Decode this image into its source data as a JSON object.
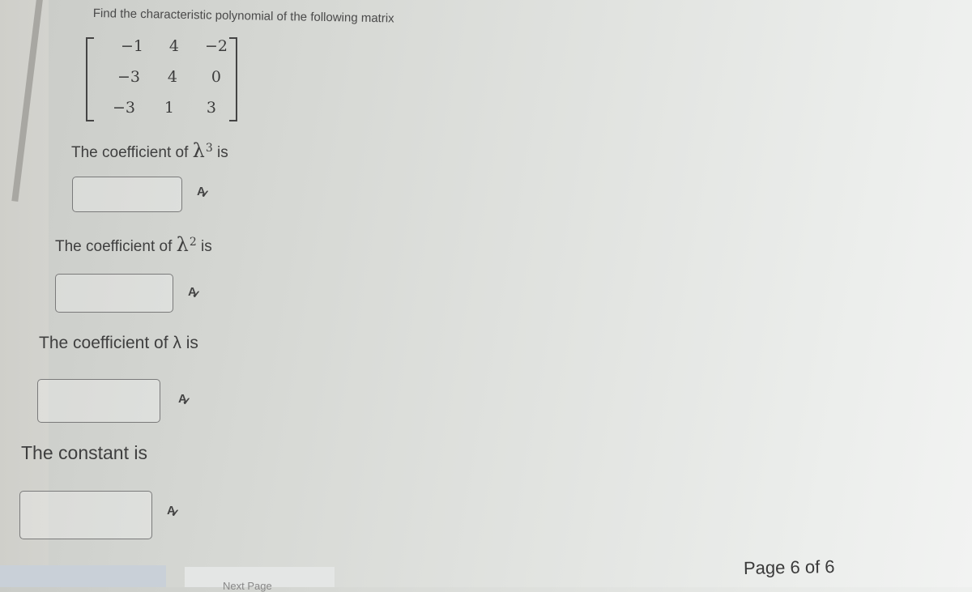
{
  "question": {
    "prompt": "Find the characteristic polynomial of the following matrix",
    "matrix": [
      [
        "−1",
        "4",
        "−2"
      ],
      [
        "−3",
        "4",
        "0"
      ],
      [
        "−3",
        "1",
        "3"
      ]
    ]
  },
  "fields": [
    {
      "label_prefix": "The coefficient of ",
      "symbol": "λ",
      "exponent": "3",
      "label_suffix": " is",
      "value": "",
      "icon": "spellcheck-icon"
    },
    {
      "label_prefix": "The coefficient of ",
      "symbol": "λ",
      "exponent": "2",
      "label_suffix": " is",
      "value": "",
      "icon": "spellcheck-icon"
    },
    {
      "label_prefix": "The coefficient of ",
      "symbol": "λ",
      "exponent": "",
      "label_suffix": " is",
      "value": "",
      "icon": "spellcheck-icon"
    },
    {
      "label_prefix": "The constant is",
      "symbol": "",
      "exponent": "",
      "label_suffix": "",
      "value": "",
      "icon": "spellcheck-icon"
    }
  ],
  "footer": {
    "page_indicator": "Page 6 of 6",
    "next_page_label": "Next Page"
  }
}
